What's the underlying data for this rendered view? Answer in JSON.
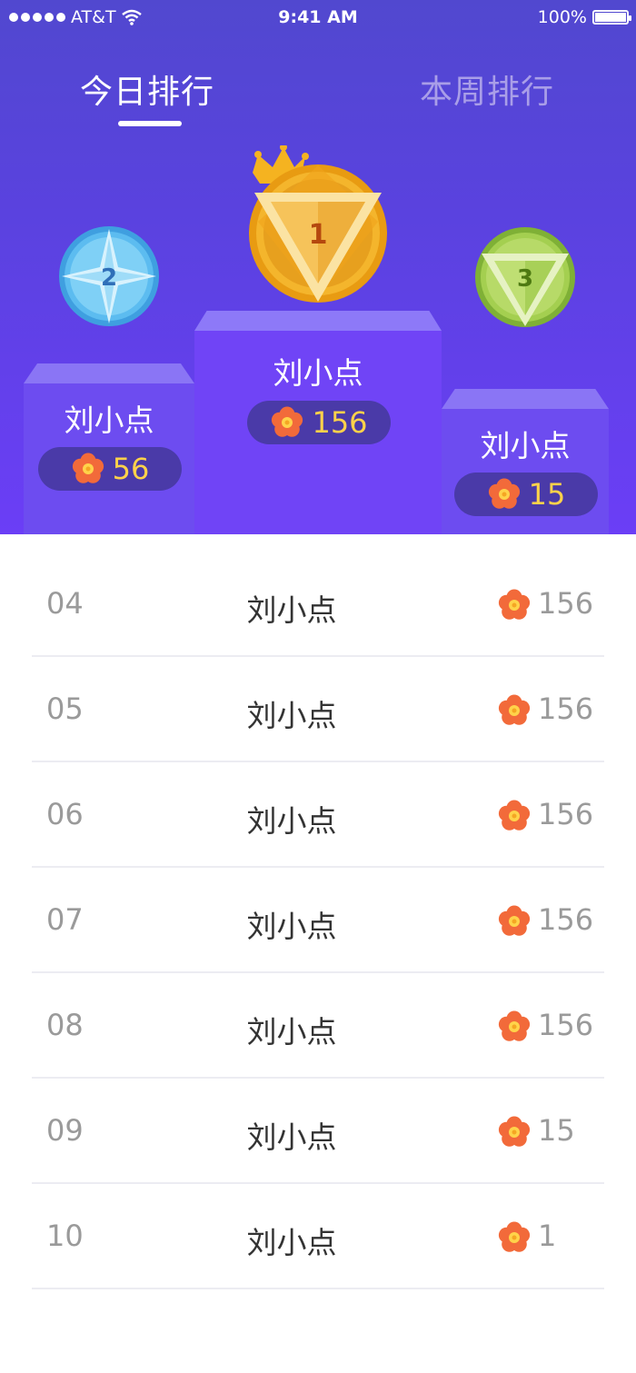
{
  "status_bar": {
    "carrier": "AT&T",
    "time": "9:41 AM",
    "battery": "100%"
  },
  "tabs": [
    {
      "label": "今日排行"
    },
    {
      "label": "本周排行"
    }
  ],
  "podium": {
    "first": {
      "rank": "1",
      "name": "刘小点",
      "score": "156"
    },
    "second": {
      "rank": "2",
      "name": "刘小点",
      "score": "56"
    },
    "third": {
      "rank": "3",
      "name": "刘小点",
      "score": "15"
    }
  },
  "list": [
    {
      "rank": "04",
      "name": "刘小点",
      "score": "156"
    },
    {
      "rank": "05",
      "name": "刘小点",
      "score": "156"
    },
    {
      "rank": "06",
      "name": "刘小点",
      "score": "156"
    },
    {
      "rank": "07",
      "name": "刘小点",
      "score": "156"
    },
    {
      "rank": "08",
      "name": "刘小点",
      "score": "156"
    },
    {
      "rank": "09",
      "name": "刘小点",
      "score": "15"
    },
    {
      "rank": "10",
      "name": "刘小点",
      "score": "1"
    }
  ],
  "icons": {
    "score": "flower-icon",
    "wifi": "wifi-icon",
    "battery": "battery-icon",
    "crown": "crown-icon"
  },
  "colors": {
    "header_top": "#5148cf",
    "header_bottom": "#6b3ef6",
    "score_gold": "#ffd24a",
    "medal_gold": "#f0a81c",
    "medal_blue": "#49b0e8",
    "medal_green": "#9bc843"
  }
}
